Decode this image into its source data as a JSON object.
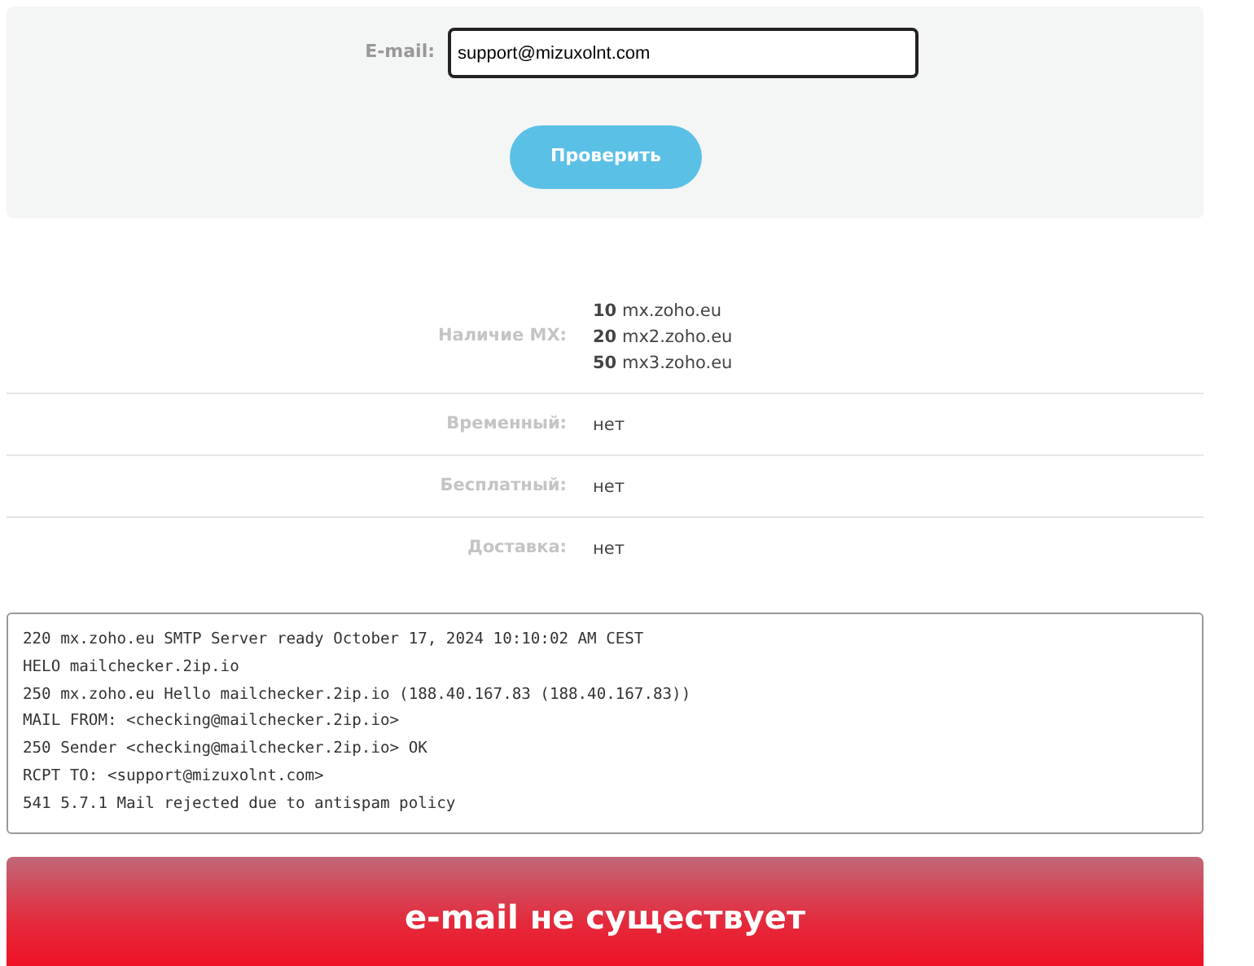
{
  "form": {
    "email_label": "E-mail:",
    "email_value": "support@mizuxolnt.com",
    "check_button": "Проверить"
  },
  "results": [
    {
      "label": "Наличие MX:",
      "values": [
        "**10** mx.zoho.eu",
        "**20** mx2.zoho.eu",
        "**50** mx3.zoho.eu"
      ]
    },
    {
      "label": "Временный:",
      "values": [
        "нет"
      ]
    },
    {
      "label": "Бесплатный:",
      "values": [
        "нет"
      ]
    },
    {
      "label": "Доставка:",
      "values": [
        "нет"
      ]
    }
  ],
  "smtp_log": [
    "220 mx.zoho.eu SMTP Server ready October 17, 2024 10:10:02 AM CEST",
    "HELO mailchecker.2ip.io",
    "250 mx.zoho.eu Hello mailchecker.2ip.io (188.40.167.83 (188.40.167.83))",
    "MAIL FROM: <checking@mailchecker.2ip.io>",
    "250 Sender <checking@mailchecker.2ip.io> OK",
    "RCPT TO: <support@mizuxolnt.com>",
    "541 5.7.1 Mail rejected due to antispam policy"
  ],
  "verdict": "e-mail не существует"
}
